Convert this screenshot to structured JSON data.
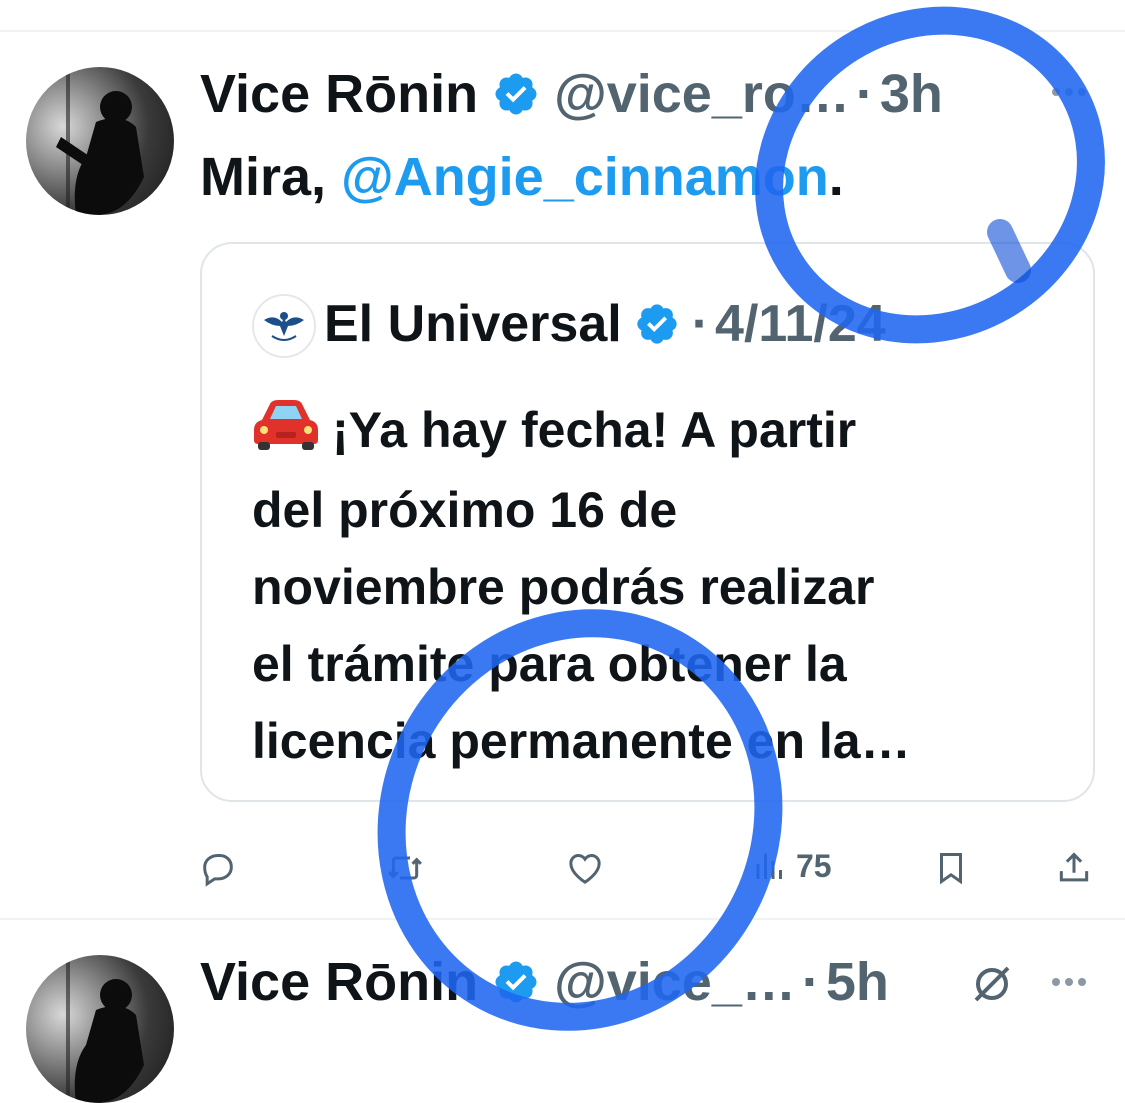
{
  "tweet1": {
    "display_name": "Vice Rōnin",
    "handle": "@vice_ro…",
    "separator": "·",
    "time": "3h",
    "text_prefix": "Mira, ",
    "mention": "@Angie_cinnamon",
    "text_suffix": ".",
    "verified_icon": "verified-badge-icon",
    "quote": {
      "source_name": "El Universal",
      "separator": "·",
      "date": "4/11/24",
      "emoji": "car-icon",
      "lines": [
        "¡Ya hay fecha! A partir",
        "del próximo 16 de",
        "noviembre podrás realizar",
        "el trámite para obtener la",
        "licencia permanente en la…"
      ]
    },
    "actions": {
      "reply_icon": "reply-icon",
      "retweet_icon": "retweet-icon",
      "like_icon": "heart-icon",
      "views_icon": "views-icon",
      "views_count": "75",
      "bookmark_icon": "bookmark-icon",
      "share_icon": "share-icon"
    }
  },
  "tweet2": {
    "display_name": "Vice Rōnin",
    "handle": "@vice_…",
    "separator": "·",
    "time": "5h",
    "muted_icon": "no-symbol-icon"
  },
  "colors": {
    "accent": "#1d9bf0",
    "muted_text": "#536471",
    "highlight_marker": "#1f66f0"
  }
}
